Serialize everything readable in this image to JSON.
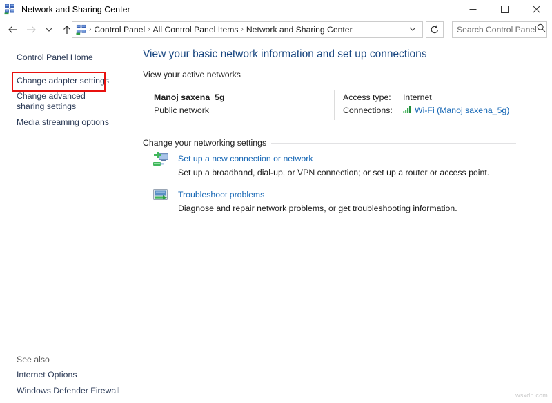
{
  "window": {
    "title": "Network and Sharing Center",
    "icon": "network-sharing-icon",
    "minimize_label": "─",
    "maximize_label": "□",
    "close_label": "✕"
  },
  "navigation": {
    "back_label": "←",
    "forward_label": "→",
    "history_label": "⌄",
    "up_label": "↑",
    "breadcrumb": [
      "Control Panel",
      "All Control Panel Items",
      "Network and Sharing Center"
    ],
    "breadcrumb_separator": "›",
    "dropdown_label": "⌄",
    "refresh_label": "↻"
  },
  "search": {
    "placeholder": "Search Control Panel",
    "value": "",
    "icon": "search-icon"
  },
  "sidebar": {
    "items": [
      {
        "label": "Control Panel Home",
        "highlighted": false
      },
      {
        "label": "Change adapter settings",
        "highlighted": true
      },
      {
        "label": "Change advanced sharing settings",
        "highlighted": false
      },
      {
        "label": "Media streaming options",
        "highlighted": false
      }
    ],
    "see_also": {
      "heading": "See also",
      "items": [
        "Internet Options",
        "Windows Defender Firewall"
      ]
    }
  },
  "main": {
    "heading": "View your basic network information and set up connections",
    "active_networks": {
      "section_title": "View your active networks",
      "network_name": "Manoj saxena_5g",
      "network_type": "Public network",
      "access_type_label": "Access type:",
      "access_type_value": "Internet",
      "connections_label": "Connections:",
      "connection_name": "Wi-Fi (Manoj saxena_5g)",
      "connection_icon": "wifi-signal-icon"
    },
    "networking_settings": {
      "section_title": "Change your networking settings",
      "tasks": [
        {
          "icon": "new-connection-icon",
          "link": "Set up a new connection or network",
          "description": "Set up a broadband, dial-up, or VPN connection; or set up a router or access point."
        },
        {
          "icon": "troubleshoot-icon",
          "link": "Troubleshoot problems",
          "description": "Diagnose and repair network problems, or get troubleshooting information."
        }
      ]
    }
  },
  "watermark": "wsxdn.com",
  "colors": {
    "heading_blue": "#17457f",
    "link_blue": "#1667b5",
    "sidebar_link": "#2b3a56",
    "highlight_red": "#e8110f",
    "wifi_green": "#2f9e44"
  }
}
